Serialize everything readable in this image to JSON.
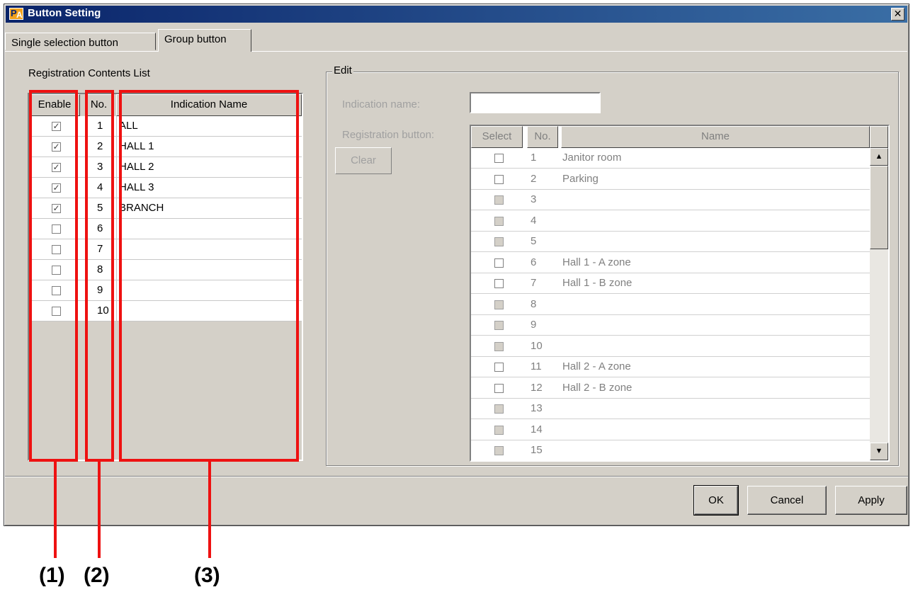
{
  "window": {
    "title": "Button Setting",
    "app_icon": "pa-logo-icon",
    "close_label": "✕"
  },
  "tabs": [
    {
      "label": "Single selection button",
      "active": false
    },
    {
      "label": "Group button",
      "active": true
    }
  ],
  "list": {
    "title": "Registration Contents List",
    "columns": [
      "Enable",
      "No.",
      "Indication Name"
    ],
    "rows": [
      {
        "enabled": true,
        "no": "1",
        "name": "ALL"
      },
      {
        "enabled": true,
        "no": "2",
        "name": "HALL 1"
      },
      {
        "enabled": true,
        "no": "3",
        "name": "HALL 2"
      },
      {
        "enabled": true,
        "no": "4",
        "name": "HALL 3"
      },
      {
        "enabled": true,
        "no": "5",
        "name": "BRANCH"
      },
      {
        "enabled": false,
        "no": "6",
        "name": ""
      },
      {
        "enabled": false,
        "no": "7",
        "name": ""
      },
      {
        "enabled": false,
        "no": "8",
        "name": ""
      },
      {
        "enabled": false,
        "no": "9",
        "name": ""
      },
      {
        "enabled": false,
        "no": "10",
        "name": ""
      }
    ]
  },
  "edit": {
    "legend": "Edit",
    "indication_label": "Indication name:",
    "indication_value": "",
    "registration_label": "Registration button:",
    "clear_label": "Clear",
    "columns": [
      "Select",
      "No.",
      "Name"
    ],
    "rows": [
      {
        "no": "1",
        "name": "Janitor room",
        "available": true
      },
      {
        "no": "2",
        "name": "Parking",
        "available": true
      },
      {
        "no": "3",
        "name": "",
        "available": false
      },
      {
        "no": "4",
        "name": "",
        "available": false
      },
      {
        "no": "5",
        "name": "",
        "available": false
      },
      {
        "no": "6",
        "name": "Hall 1 - A zone",
        "available": true
      },
      {
        "no": "7",
        "name": "Hall 1 - B zone",
        "available": true
      },
      {
        "no": "8",
        "name": "",
        "available": false
      },
      {
        "no": "9",
        "name": "",
        "available": false
      },
      {
        "no": "10",
        "name": "",
        "available": false
      },
      {
        "no": "11",
        "name": "Hall 2 - A zone",
        "available": true
      },
      {
        "no": "12",
        "name": "Hall 2 - B zone",
        "available": true
      },
      {
        "no": "13",
        "name": "",
        "available": false
      },
      {
        "no": "14",
        "name": "",
        "available": false
      },
      {
        "no": "15",
        "name": "",
        "available": false
      }
    ],
    "scroll_up": "▲",
    "scroll_down": "▼"
  },
  "buttons": {
    "ok": "OK",
    "cancel": "Cancel",
    "apply": "Apply"
  },
  "annotations": {
    "callout_1": "(1)",
    "callout_2": "(2)",
    "callout_3": "(3)",
    "color": "#ee1111"
  }
}
